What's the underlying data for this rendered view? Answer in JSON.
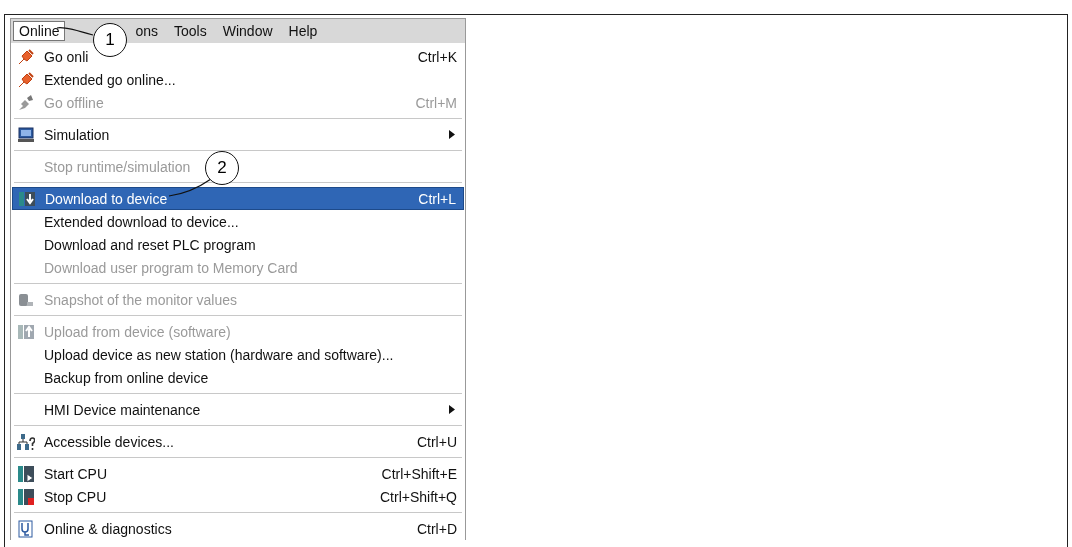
{
  "menu_bar": [
    {
      "label": "Online",
      "selected": true
    },
    {
      "label": "ons",
      "selected": false
    },
    {
      "label": "Tools",
      "selected": false
    },
    {
      "label": "Window",
      "selected": false
    },
    {
      "label": "Help",
      "selected": false
    }
  ],
  "menu": [
    [
      {
        "kind": "plug",
        "label": "Go onli",
        "shortcut": "Ctrl+K",
        "disabled": false,
        "submenu": false,
        "selected": false
      },
      {
        "kind": "plug",
        "label": "Extended go online...",
        "disabled": false,
        "submenu": false,
        "selected": false
      },
      {
        "kind": "plug-off",
        "label": "Go offline",
        "shortcut": "Ctrl+M",
        "disabled": true,
        "submenu": false,
        "selected": false
      }
    ],
    [
      {
        "kind": "monitor",
        "label": "Simulation",
        "disabled": false,
        "submenu": true,
        "selected": false
      }
    ],
    [
      {
        "label": "Stop runtime/simulation",
        "disabled": true,
        "submenu": false,
        "selected": false
      }
    ],
    [
      {
        "kind": "download",
        "label": "Download to device",
        "shortcut": "Ctrl+L",
        "disabled": false,
        "submenu": false,
        "selected": true
      },
      {
        "label": "Extended download to device...",
        "disabled": false,
        "submenu": false,
        "selected": false
      },
      {
        "label": "Download and reset PLC program",
        "disabled": false,
        "submenu": false,
        "selected": false
      },
      {
        "label": "Download user program to Memory Card",
        "disabled": true,
        "submenu": false,
        "selected": false
      }
    ],
    [
      {
        "kind": "snapshot",
        "label": "Snapshot of the monitor values",
        "disabled": true,
        "submenu": false,
        "selected": false
      }
    ],
    [
      {
        "kind": "upload",
        "label": "Upload from device (software)",
        "disabled": true,
        "submenu": false,
        "selected": false
      },
      {
        "label": "Upload device as new station (hardware and software)...",
        "disabled": false,
        "submenu": false,
        "selected": false
      },
      {
        "label": "Backup from online device",
        "disabled": false,
        "submenu": false,
        "selected": false
      }
    ],
    [
      {
        "label": "HMI Device maintenance",
        "disabled": false,
        "submenu": true,
        "selected": false
      }
    ],
    [
      {
        "kind": "network",
        "label": "Accessible devices...",
        "shortcut": "Ctrl+U",
        "disabled": false,
        "submenu": false,
        "selected": false
      }
    ],
    [
      {
        "kind": "start",
        "label": "Start CPU",
        "shortcut": "Ctrl+Shift+E",
        "disabled": false,
        "submenu": false,
        "selected": false
      },
      {
        "kind": "stop",
        "label": "Stop CPU",
        "shortcut": "Ctrl+Shift+Q",
        "disabled": false,
        "submenu": false,
        "selected": false
      }
    ],
    [
      {
        "kind": "diagnostics",
        "label": "Online & diagnostics",
        "shortcut": "Ctrl+D",
        "disabled": false,
        "submenu": false,
        "selected": false
      }
    ]
  ],
  "callouts": [
    {
      "number": "1"
    },
    {
      "number": "2"
    }
  ]
}
